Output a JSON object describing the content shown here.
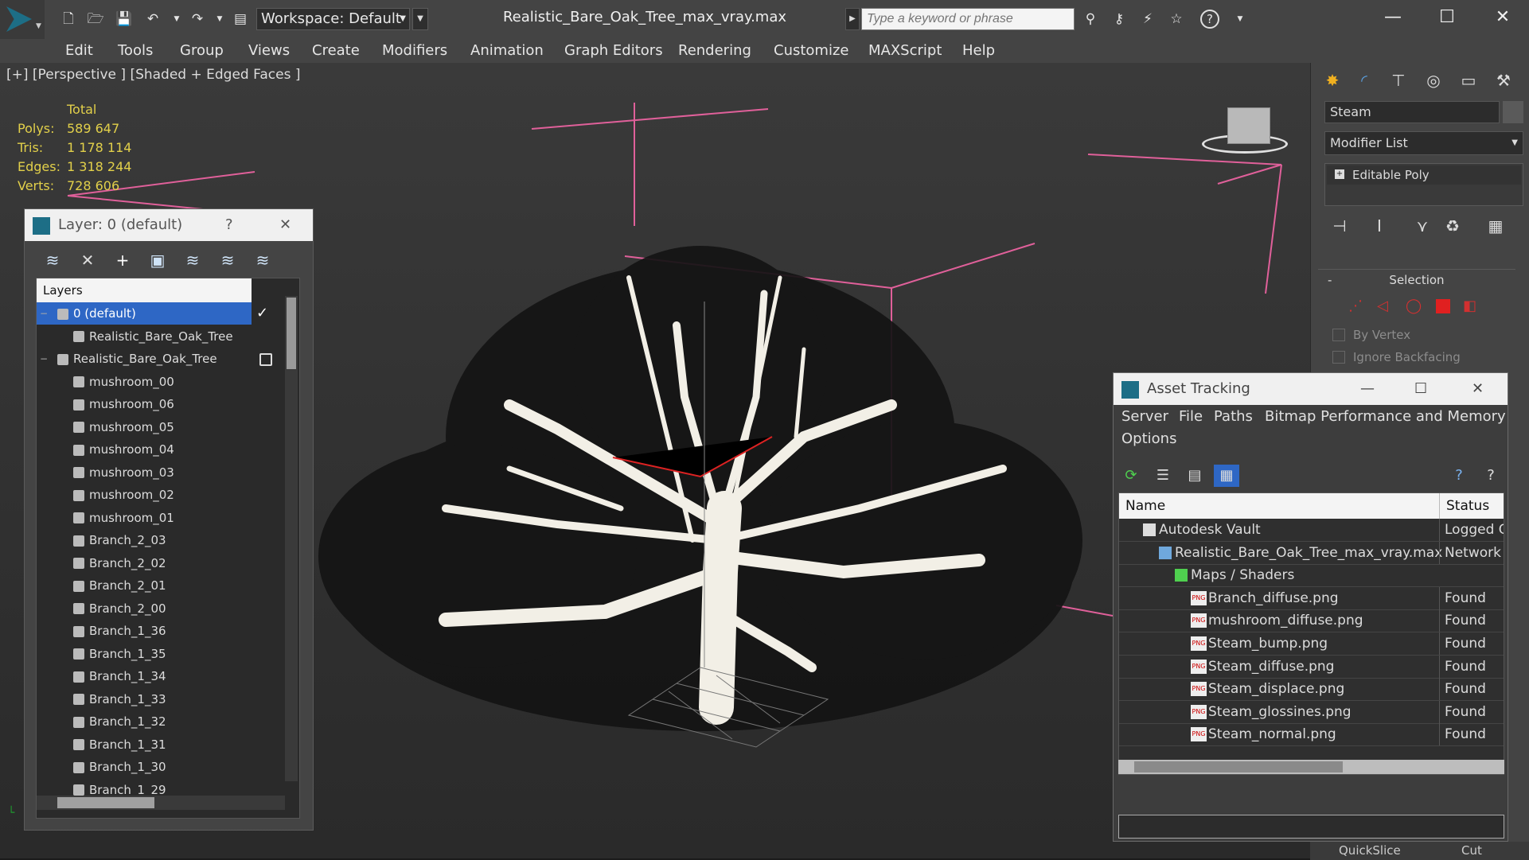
{
  "app": {
    "workspace": "Workspace: Default",
    "doc_title": "Realistic_Bare_Oak_Tree_max_vray.max",
    "search_placeholder": "Type a keyword or phrase",
    "help_glyph": "?"
  },
  "menu": [
    "Edit",
    "Tools",
    "Group",
    "Views",
    "Create",
    "Modifiers",
    "Animation",
    "Graph Editors",
    "Rendering",
    "Customize",
    "MAXScript",
    "Help"
  ],
  "viewport": {
    "label": "[+] [Perspective ] [Shaded + Edged Faces ]",
    "stats_header": "Total",
    "stats": [
      {
        "label": "Polys:",
        "value": "589 647"
      },
      {
        "label": "Tris:",
        "value": "1 178 114"
      },
      {
        "label": "Edges:",
        "value": "1 318 244"
      },
      {
        "label": "Verts:",
        "value": "728 606"
      }
    ]
  },
  "layer_dialog": {
    "title": "Layer: 0 (default)",
    "help": "?",
    "close": "✕",
    "header": "Layers",
    "rows": [
      {
        "label": "0 (default)",
        "indent": 1,
        "selected": true,
        "expander": "−",
        "active_mark": "✓"
      },
      {
        "label": "Realistic_Bare_Oak_Tree",
        "indent": 2
      },
      {
        "label": "Realistic_Bare_Oak_Tree",
        "indent": 1,
        "expander": "−",
        "box": true
      },
      {
        "label": "mushroom_00",
        "indent": 2
      },
      {
        "label": "mushroom_06",
        "indent": 2
      },
      {
        "label": "mushroom_05",
        "indent": 2
      },
      {
        "label": "mushroom_04",
        "indent": 2
      },
      {
        "label": "mushroom_03",
        "indent": 2
      },
      {
        "label": "mushroom_02",
        "indent": 2
      },
      {
        "label": "mushroom_01",
        "indent": 2
      },
      {
        "label": "Branch_2_03",
        "indent": 2
      },
      {
        "label": "Branch_2_02",
        "indent": 2
      },
      {
        "label": "Branch_2_01",
        "indent": 2
      },
      {
        "label": "Branch_2_00",
        "indent": 2
      },
      {
        "label": "Branch_1_36",
        "indent": 2
      },
      {
        "label": "Branch_1_35",
        "indent": 2
      },
      {
        "label": "Branch_1_34",
        "indent": 2
      },
      {
        "label": "Branch_1_33",
        "indent": 2
      },
      {
        "label": "Branch_1_32",
        "indent": 2
      },
      {
        "label": "Branch_1_31",
        "indent": 2
      },
      {
        "label": "Branch_1_30",
        "indent": 2
      },
      {
        "label": "Branch_1_29",
        "indent": 2
      }
    ]
  },
  "command_panel": {
    "object_name": "Steam",
    "modifier_list": "Modifier List",
    "stack_item": "Editable Poly",
    "rollout": "Selection",
    "rollout_toggle": "-",
    "by_vertex": "By Vertex",
    "ignore_backfacing": "Ignore Backfacing",
    "bottom_left": "QuickSlice",
    "bottom_right": "Cut"
  },
  "asset_tracking": {
    "title": "Asset Tracking",
    "menu": [
      "Server",
      "File",
      "Paths",
      "Bitmap Performance and Memory",
      "Options"
    ],
    "columns": {
      "name": "Name",
      "status": "Status"
    },
    "rows": [
      {
        "name": "Autodesk Vault",
        "status": "Logged O",
        "level": 1,
        "icon": "vault"
      },
      {
        "name": "Realistic_Bare_Oak_Tree_max_vray.max",
        "status": "Network F",
        "level": 2,
        "icon": "max"
      },
      {
        "name": "Maps / Shaders",
        "status": "",
        "level": 3,
        "icon": "maps"
      },
      {
        "name": "Branch_diffuse.png",
        "status": "Found",
        "level": 4,
        "icon": "png"
      },
      {
        "name": "mushroom_diffuse.png",
        "status": "Found",
        "level": 4,
        "icon": "png"
      },
      {
        "name": "Steam_bump.png",
        "status": "Found",
        "level": 4,
        "icon": "png"
      },
      {
        "name": "Steam_diffuse.png",
        "status": "Found",
        "level": 4,
        "icon": "png"
      },
      {
        "name": "Steam_displace.png",
        "status": "Found",
        "level": 4,
        "icon": "png"
      },
      {
        "name": "Steam_glossines.png",
        "status": "Found",
        "level": 4,
        "icon": "png"
      },
      {
        "name": "Steam_normal.png",
        "status": "Found",
        "level": 4,
        "icon": "png"
      }
    ],
    "png_badge": "PNG"
  }
}
